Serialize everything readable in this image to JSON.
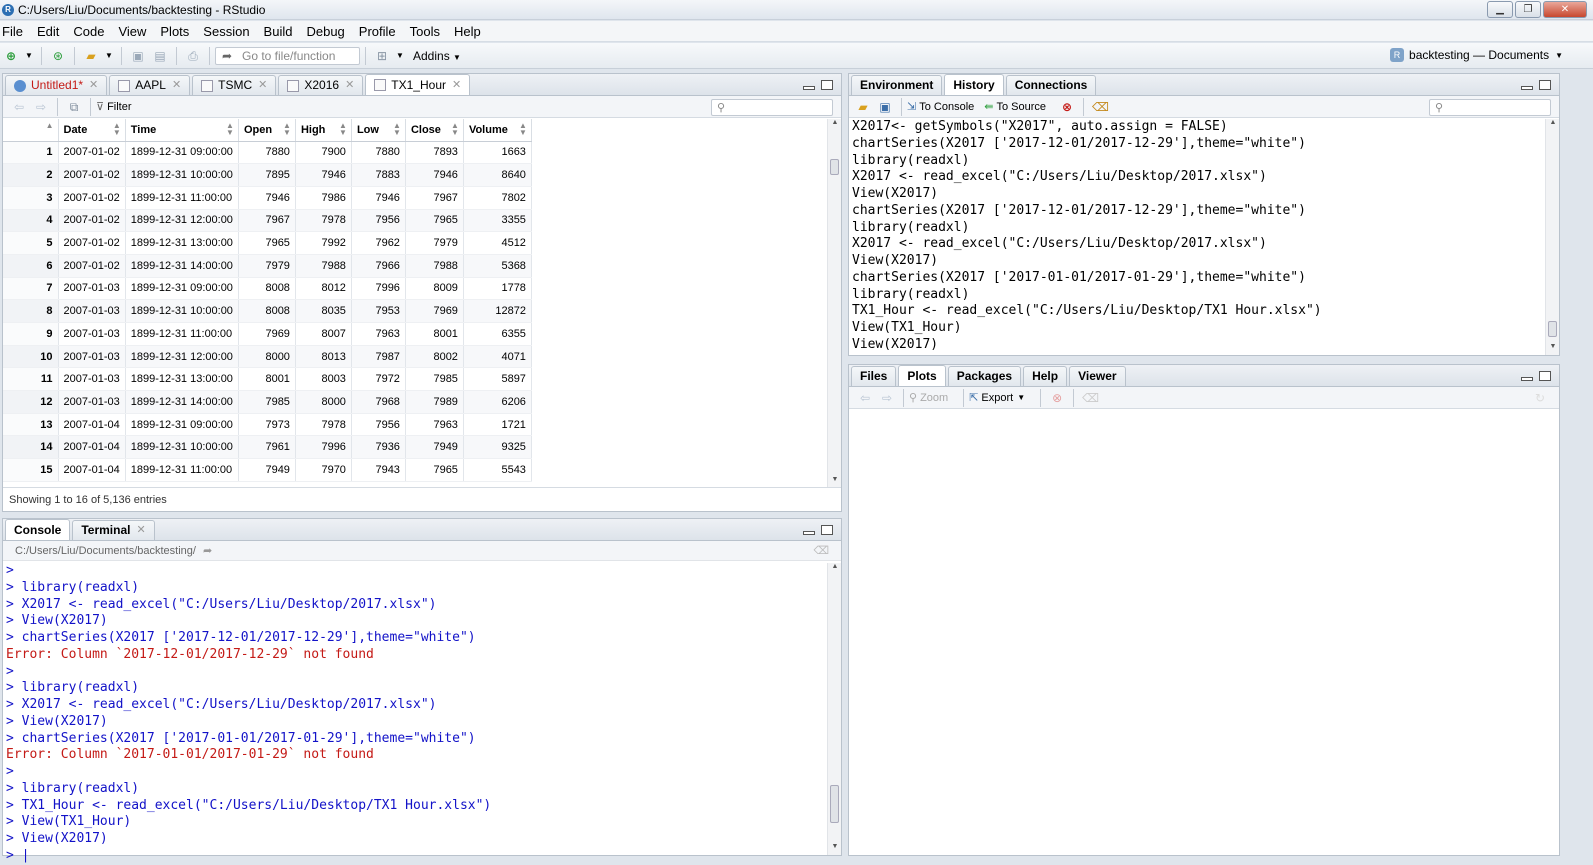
{
  "window": {
    "title": "C:/Users/Liu/Documents/backtesting - RStudio",
    "app_icon": "R"
  },
  "menu": [
    "File",
    "Edit",
    "Code",
    "View",
    "Plots",
    "Session",
    "Build",
    "Debug",
    "Profile",
    "Tools",
    "Help"
  ],
  "toolbar": {
    "goto_placeholder": "Go to file/function",
    "addins_label": "Addins",
    "project_label": "backtesting — Documents",
    "project_icon": "R"
  },
  "source_pane": {
    "tabs": [
      {
        "label": "Untitled1*",
        "type": "r-script",
        "modified": true
      },
      {
        "label": "AAPL",
        "type": "data"
      },
      {
        "label": "TSMC",
        "type": "data"
      },
      {
        "label": "X2016",
        "type": "data"
      },
      {
        "label": "TX1_Hour",
        "type": "data",
        "active": true
      }
    ],
    "filter_label": "Filter",
    "columns": [
      "Date",
      "Time",
      "Open",
      "High",
      "Low",
      "Close",
      "Volume"
    ],
    "rows": [
      [
        "1",
        "2007-01-02",
        "1899-12-31 09:00:00",
        "7880",
        "7900",
        "7880",
        "7893",
        "1663"
      ],
      [
        "2",
        "2007-01-02",
        "1899-12-31 10:00:00",
        "7895",
        "7946",
        "7883",
        "7946",
        "8640"
      ],
      [
        "3",
        "2007-01-02",
        "1899-12-31 11:00:00",
        "7946",
        "7986",
        "7946",
        "7967",
        "7802"
      ],
      [
        "4",
        "2007-01-02",
        "1899-12-31 12:00:00",
        "7967",
        "7978",
        "7956",
        "7965",
        "3355"
      ],
      [
        "5",
        "2007-01-02",
        "1899-12-31 13:00:00",
        "7965",
        "7992",
        "7962",
        "7979",
        "4512"
      ],
      [
        "6",
        "2007-01-02",
        "1899-12-31 14:00:00",
        "7979",
        "7988",
        "7966",
        "7988",
        "5368"
      ],
      [
        "7",
        "2007-01-03",
        "1899-12-31 09:00:00",
        "8008",
        "8012",
        "7996",
        "8009",
        "1778"
      ],
      [
        "8",
        "2007-01-03",
        "1899-12-31 10:00:00",
        "8008",
        "8035",
        "7953",
        "7969",
        "12872"
      ],
      [
        "9",
        "2007-01-03",
        "1899-12-31 11:00:00",
        "7969",
        "8007",
        "7963",
        "8001",
        "6355"
      ],
      [
        "10",
        "2007-01-03",
        "1899-12-31 12:00:00",
        "8000",
        "8013",
        "7987",
        "8002",
        "4071"
      ],
      [
        "11",
        "2007-01-03",
        "1899-12-31 13:00:00",
        "8001",
        "8003",
        "7972",
        "7985",
        "5897"
      ],
      [
        "12",
        "2007-01-03",
        "1899-12-31 14:00:00",
        "7985",
        "8000",
        "7968",
        "7989",
        "6206"
      ],
      [
        "13",
        "2007-01-04",
        "1899-12-31 09:00:00",
        "7973",
        "7978",
        "7956",
        "7963",
        "1721"
      ],
      [
        "14",
        "2007-01-04",
        "1899-12-31 10:00:00",
        "7961",
        "7996",
        "7936",
        "7949",
        "9325"
      ],
      [
        "15",
        "2007-01-04",
        "1899-12-31 11:00:00",
        "7949",
        "7970",
        "7943",
        "7965",
        "5543"
      ]
    ],
    "status": "Showing 1 to 16 of 5,136 entries"
  },
  "console_pane": {
    "tabs": [
      {
        "label": "Console",
        "active": true
      },
      {
        "label": "Terminal"
      }
    ],
    "path": "C:/Users/Liu/Documents/backtesting/",
    "lines": [
      {
        "text": ">",
        "kind": "cmd"
      },
      {
        "text": "> library(readxl)",
        "kind": "cmd"
      },
      {
        "text": "> X2017 <- read_excel(\"C:/Users/Liu/Desktop/2017.xlsx\")",
        "kind": "cmd"
      },
      {
        "text": "> View(X2017)",
        "kind": "cmd"
      },
      {
        "text": "> chartSeries(X2017 ['2017-12-01/2017-12-29'],theme=\"white\")",
        "kind": "cmd"
      },
      {
        "text": "Error: Column `2017-12-01/2017-12-29` not found",
        "kind": "err"
      },
      {
        "text": ">",
        "kind": "cmd"
      },
      {
        "text": "> library(readxl)",
        "kind": "cmd"
      },
      {
        "text": "> X2017 <- read_excel(\"C:/Users/Liu/Desktop/2017.xlsx\")",
        "kind": "cmd"
      },
      {
        "text": "> View(X2017)",
        "kind": "cmd"
      },
      {
        "text": "> chartSeries(X2017 ['2017-01-01/2017-01-29'],theme=\"white\")",
        "kind": "cmd"
      },
      {
        "text": "Error: Column `2017-01-01/2017-01-29` not found",
        "kind": "err"
      },
      {
        "text": ">",
        "kind": "cmd"
      },
      {
        "text": "> library(readxl)",
        "kind": "cmd"
      },
      {
        "text": "> TX1_Hour <- read_excel(\"C:/Users/Liu/Desktop/TX1 Hour.xlsx\")",
        "kind": "cmd"
      },
      {
        "text": "> View(TX1_Hour)",
        "kind": "cmd"
      },
      {
        "text": "> View(X2017)",
        "kind": "cmd"
      },
      {
        "text": "> |",
        "kind": "cmd"
      }
    ]
  },
  "env_pane": {
    "tabs": [
      {
        "label": "Environment"
      },
      {
        "label": "History",
        "active": true
      },
      {
        "label": "Connections"
      }
    ],
    "to_console": "To Console",
    "to_source": "To Source",
    "history": [
      "X2017<- getSymbols(\"X2017\", auto.assign = FALSE)",
      "chartSeries(X2017 ['2017-12-01/2017-12-29'],theme=\"white\")",
      "library(readxl)",
      "X2017 <- read_excel(\"C:/Users/Liu/Desktop/2017.xlsx\")",
      "View(X2017)",
      "chartSeries(X2017 ['2017-12-01/2017-12-29'],theme=\"white\")",
      "library(readxl)",
      "X2017 <- read_excel(\"C:/Users/Liu/Desktop/2017.xlsx\")",
      "View(X2017)",
      "chartSeries(X2017 ['2017-01-01/2017-01-29'],theme=\"white\")",
      "library(readxl)",
      "TX1_Hour <- read_excel(\"C:/Users/Liu/Desktop/TX1 Hour.xlsx\")",
      "View(TX1_Hour)",
      "View(X2017)"
    ]
  },
  "files_pane": {
    "tabs": [
      {
        "label": "Files"
      },
      {
        "label": "Plots",
        "active": true
      },
      {
        "label": "Packages"
      },
      {
        "label": "Help"
      },
      {
        "label": "Viewer"
      }
    ],
    "zoom_label": "Zoom",
    "export_label": "Export"
  },
  "colors": {
    "cmd": "#1212c8",
    "err": "#c41a16",
    "accent": "#2c6fb3"
  }
}
